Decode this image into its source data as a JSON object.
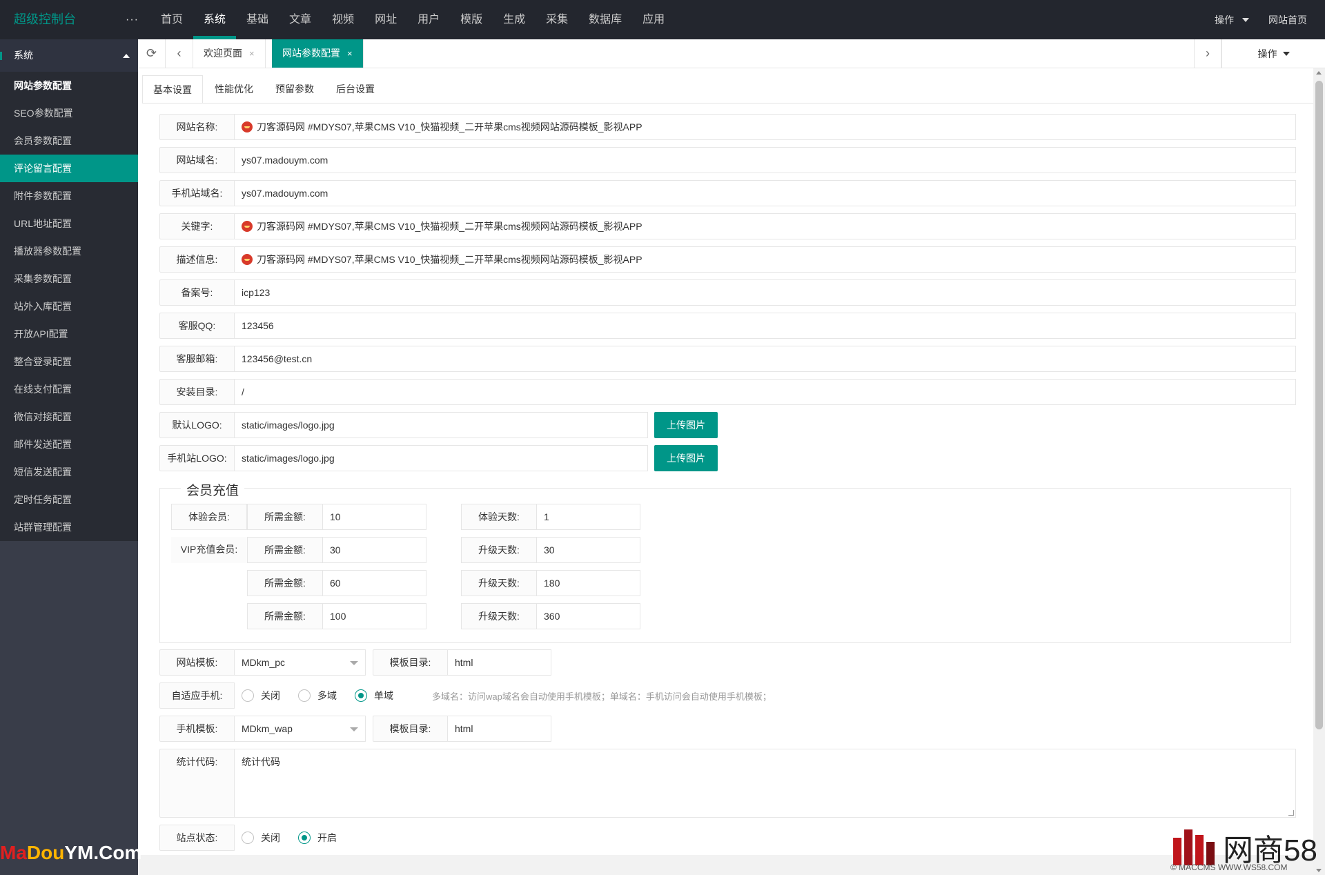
{
  "brand": "超级控制台",
  "more": "···",
  "topnav": [
    "首页",
    "系统",
    "基础",
    "文章",
    "视频",
    "网址",
    "用户",
    "模版",
    "生成",
    "采集",
    "数据库",
    "应用"
  ],
  "topright": {
    "operate": "操作",
    "home": "网站首页"
  },
  "sidebar": {
    "group": "系统",
    "items": [
      "网站参数配置",
      "SEO参数配置",
      "会员参数配置",
      "评论留言配置",
      "附件参数配置",
      "URL地址配置",
      "播放器参数配置",
      "采集参数配置",
      "站外入库配置",
      "开放API配置",
      "整合登录配置",
      "在线支付配置",
      "微信对接配置",
      "邮件发送配置",
      "短信发送配置",
      "定时任务配置",
      "站群管理配置"
    ]
  },
  "tabbar": {
    "tab1": "欢迎页面",
    "tab2": "网站参数配置",
    "close": "×",
    "operate": "操作"
  },
  "subtabs": [
    "基本设置",
    "性能优化",
    "预留参数",
    "后台设置"
  ],
  "form": {
    "site_name": {
      "label": "网站名称:",
      "value": "刀客源码网 #MDYS07,苹果CMS V10_快猫视频_二开苹果cms视频网站源码模板_影视APP"
    },
    "domain": {
      "label": "网站域名:",
      "value": "ys07.madouym.com"
    },
    "mobile_domain": {
      "label": "手机站域名:",
      "value": "ys07.madouym.com"
    },
    "keywords": {
      "label": "关键字:",
      "value": "刀客源码网 #MDYS07,苹果CMS V10_快猫视频_二开苹果cms视频网站源码模板_影视APP"
    },
    "description": {
      "label": "描述信息:",
      "value": "刀客源码网 #MDYS07,苹果CMS V10_快猫视频_二开苹果cms视频网站源码模板_影视APP"
    },
    "icp": {
      "label": "备案号:",
      "value": "icp123"
    },
    "qq": {
      "label": "客服QQ:",
      "value": "123456"
    },
    "email": {
      "label": "客服邮箱:",
      "value": "123456@test.cn"
    },
    "install_dir": {
      "label": "安装目录:",
      "value": "/"
    },
    "logo": {
      "label": "默认LOGO:",
      "value": "static/images/logo.jpg",
      "button": "上传图片"
    },
    "mobile_logo": {
      "label": "手机站LOGO:",
      "value": "static/images/logo.jpg",
      "button": "上传图片"
    }
  },
  "recharge": {
    "legend": "会员充值",
    "trial_label": "体验会员:",
    "vip_label": "VIP充值会员:",
    "amount_label": "所需金额:",
    "trial_days_label": "体验天数:",
    "upgrade_days_label": "升级天数:",
    "trial": {
      "amount": "10",
      "days": "1"
    },
    "vip": [
      {
        "amount": "30",
        "days": "30"
      },
      {
        "amount": "60",
        "days": "180"
      },
      {
        "amount": "100",
        "days": "360"
      }
    ]
  },
  "template": {
    "site_tpl_label": "网站模板:",
    "site_tpl": "MDkm_pc",
    "dir_label": "模板目录:",
    "site_dir": "html",
    "adapt_label": "自适应手机:",
    "adapt_options": [
      "关闭",
      "多域",
      "单域"
    ],
    "adapt_selected": "单域",
    "adapt_hint": "多域名：访问wap域名会自动使用手机模板；单域名：手机访问会自动使用手机模板；",
    "mobile_tpl_label": "手机模板:",
    "mobile_tpl": "MDkm_wap",
    "mobile_dir": "html"
  },
  "stats": {
    "label": "统计代码:",
    "value": "统计代码"
  },
  "site_status": {
    "label": "站点状态:",
    "options": [
      "关闭",
      "开启"
    ],
    "selected": "开启"
  },
  "watermark_left": {
    "p1": "M",
    "p2": "a",
    "p3": "Dou",
    "p4": "YM",
    "p5": ".Com"
  },
  "watermark_right": {
    "title": "网商58",
    "sub": "© MACCMS WWW.WS58.COM"
  },
  "colors": {
    "accent": "#009688",
    "topbar": "#23262e",
    "sidebar": "#393d49"
  }
}
